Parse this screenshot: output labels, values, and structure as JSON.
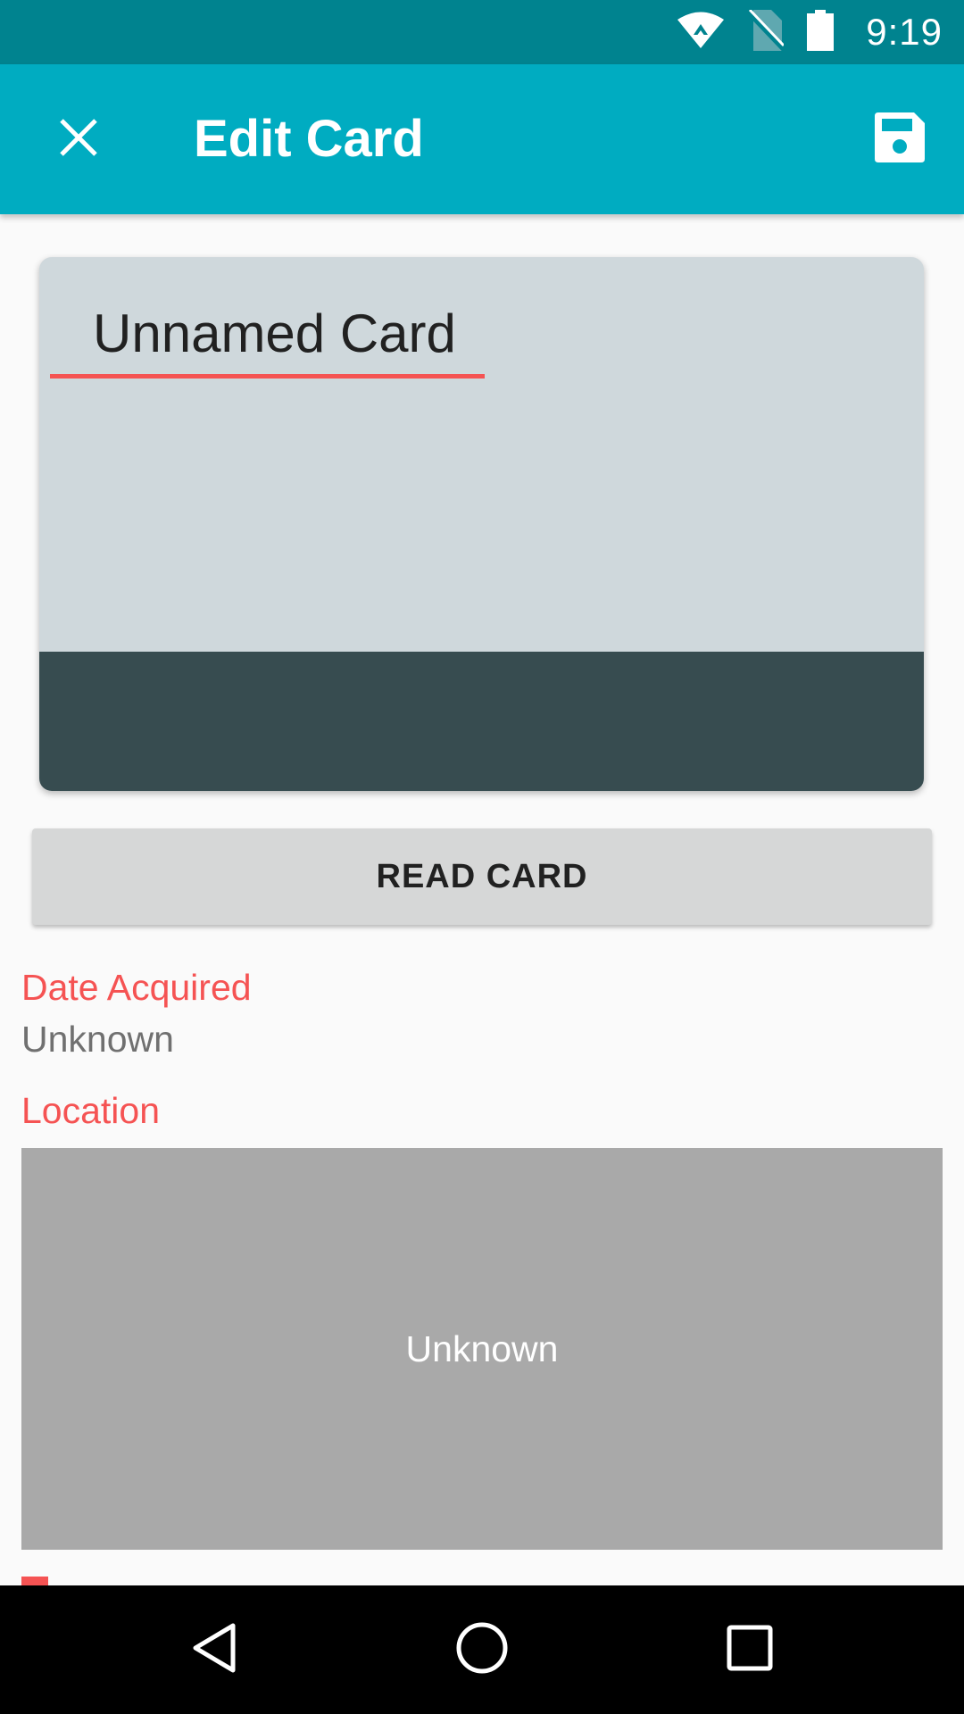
{
  "status_bar": {
    "time": "9:19",
    "icons": [
      "wifi-icon",
      "no-sim-icon",
      "battery-icon"
    ]
  },
  "app_bar": {
    "title": "Edit Card",
    "close_icon": "close-icon",
    "save_icon": "save-icon"
  },
  "card": {
    "name_value": "Unnamed Card",
    "background_color": "#cfd8dc",
    "stripe_color": "#374c50",
    "underline_color": "#f55353"
  },
  "actions": {
    "read_card_label": "READ CARD"
  },
  "fields": {
    "date_acquired_label": "Date Acquired",
    "date_acquired_value": "Unknown",
    "location_label": "Location",
    "location_value": "Unknown"
  },
  "nav_bar": {
    "icons": [
      "back-icon",
      "home-icon",
      "recents-icon"
    ]
  },
  "colors": {
    "status_bar": "#00838f",
    "app_bar": "#00acc1",
    "accent": "#f55353",
    "map_placeholder": "#a9a9a9"
  }
}
